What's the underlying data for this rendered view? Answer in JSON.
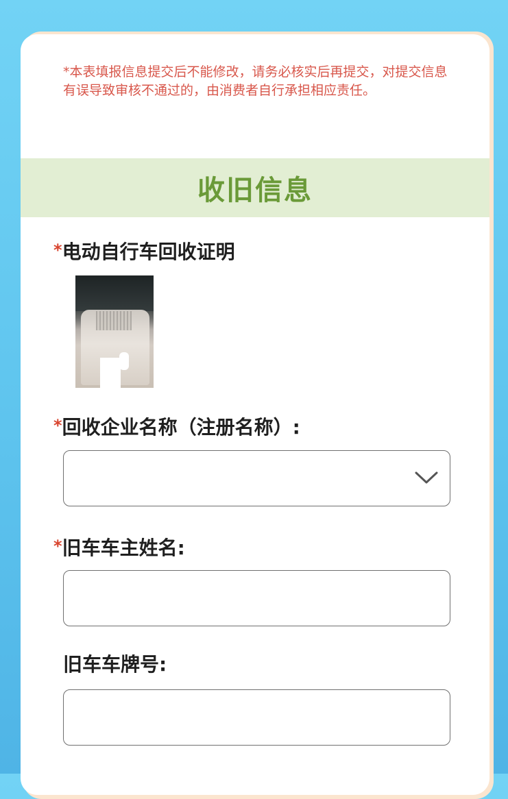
{
  "notice": {
    "text": "*本表填报信息提交后不能修改，请务必核实后再提交，对提交信息有误导致审核不通过的，由消费者自行承担相应责任。"
  },
  "section": {
    "title": "收旧信息"
  },
  "fields": {
    "certificate": {
      "required_mark": "*",
      "label": "电动自行车回收证明"
    },
    "company": {
      "required_mark": "*",
      "label": "回收企业名称（注册名称）:",
      "value": ""
    },
    "owner_name": {
      "required_mark": "*",
      "label": "旧车车主姓名:",
      "value": ""
    },
    "plate_number": {
      "label": "旧车车牌号:",
      "value": ""
    }
  },
  "icons": {
    "dropdown": "chevron-down-icon"
  },
  "colors": {
    "background": "#5ec4ee",
    "notice_text": "#d8574b",
    "section_band": "#e2eed3",
    "section_title": "#6a9a38",
    "required_mark": "#d8452f"
  }
}
